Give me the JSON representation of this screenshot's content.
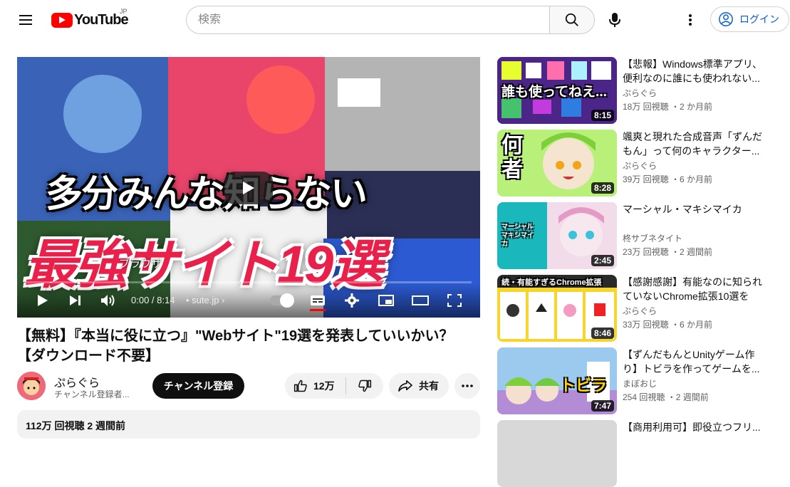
{
  "header": {
    "logo_text": "YouTube",
    "region": "JP",
    "search_placeholder": "検索",
    "login_label": "ログイン"
  },
  "player": {
    "thumb_line1": "多分みんな知らない",
    "thumb_line2": "最強サイト19選",
    "chapter_overlay": "ブラウザ",
    "time": "0:00 / 8:14",
    "chapter": "• sute.jp",
    "progress": 0
  },
  "video": {
    "title": "【無料】『本当に役に立つ』\"Webサイト\"19選を発表していいかい？【ダウンロード不要】",
    "channel_name": "ぷらぐら",
    "channel_subs": "チャンネル登録者...",
    "subscribe_label": "チャンネル登録",
    "likes": "12万",
    "share_label": "共有",
    "description_meta": "112万 回視聴  2 週間前"
  },
  "recommendations": [
    {
      "title": "【悲報】Windows標準アプリ、便利なのに誰にも使われない...",
      "channel": "ぷらぐら",
      "meta": "18万 回視聴 ・2 か月前",
      "duration": "8:15",
      "thumb_text": "誰も使ってねえ...",
      "thumb_bg": "#3a1f6e"
    },
    {
      "title": "颯爽と現れた合成音声「ずんだもん」って何のキャラクター...",
      "channel": "ぷらぐら",
      "meta": "39万 回視聴 ・6 か月前",
      "duration": "8:28",
      "thumb_text": "何者",
      "thumb_bg": "#8fd14f"
    },
    {
      "title": "マーシャル・マキシマイカ",
      "channel": "柊サブネタイト",
      "meta": "23万 回視聴 ・2 週間前",
      "duration": "2:45",
      "thumb_text": "マーシャル マキシマイカ",
      "thumb_bg": "#1bb3b8"
    },
    {
      "title": "【感謝感謝】有能なのに知られていないChrome拡張10選をお...",
      "channel": "ぷらぐら",
      "meta": "33万 回視聴 ・6 か月前",
      "duration": "8:46",
      "thumb_text": "続・有能すぎるChrome拡張",
      "thumb_bg": "#f7d52a"
    },
    {
      "title": "【ずんだもんとUnityゲーム作り】トビラを作ってゲームを...",
      "channel": "まぼおじ",
      "meta": "254 回視聴 ・2 週間前",
      "duration": "7:47",
      "thumb_text": "トビラ",
      "thumb_bg": "#7bb6e8"
    },
    {
      "title": "【商用利用可】即役立つフリ...",
      "channel": "",
      "meta": "",
      "duration": "",
      "thumb_text": "",
      "thumb_bg": "#d8d8d8"
    }
  ]
}
